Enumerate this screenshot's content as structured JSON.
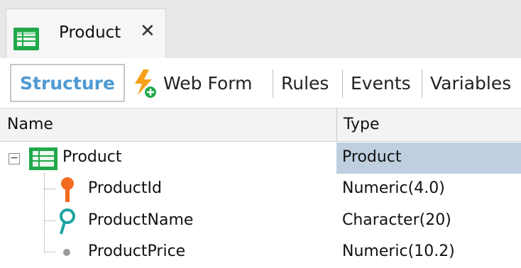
{
  "doc_tab": {
    "title": "Product",
    "close": "✕",
    "icon": "transaction-icon"
  },
  "toolbar": {
    "tabs": [
      {
        "label": "Structure",
        "active": true
      },
      {
        "label": "Web Form",
        "icon": "web-form-icon"
      },
      {
        "label": "Rules"
      },
      {
        "label": "Events"
      },
      {
        "label": "Variables"
      }
    ]
  },
  "grid": {
    "columns": {
      "name": "Name",
      "type": "Type"
    },
    "rows": [
      {
        "name": "Product",
        "type": "Product",
        "icon": "transaction-icon",
        "expander": "−",
        "selected": true
      },
      {
        "name": "ProductId",
        "type": "Numeric(4.0)",
        "icon": "primary-key-icon"
      },
      {
        "name": "ProductName",
        "type": "Character(20)",
        "icon": "description-attribute-icon"
      },
      {
        "name": "ProductPrice",
        "type": "Numeric(10.2)",
        "icon": "attribute-dot-icon"
      }
    ]
  },
  "colors": {
    "accent": "#4f9ad3",
    "selected_row": "#bfcfe0",
    "key_orange": "#f26b21",
    "desc_teal": "#1ba3a3",
    "green_icon": "#21a84a"
  }
}
